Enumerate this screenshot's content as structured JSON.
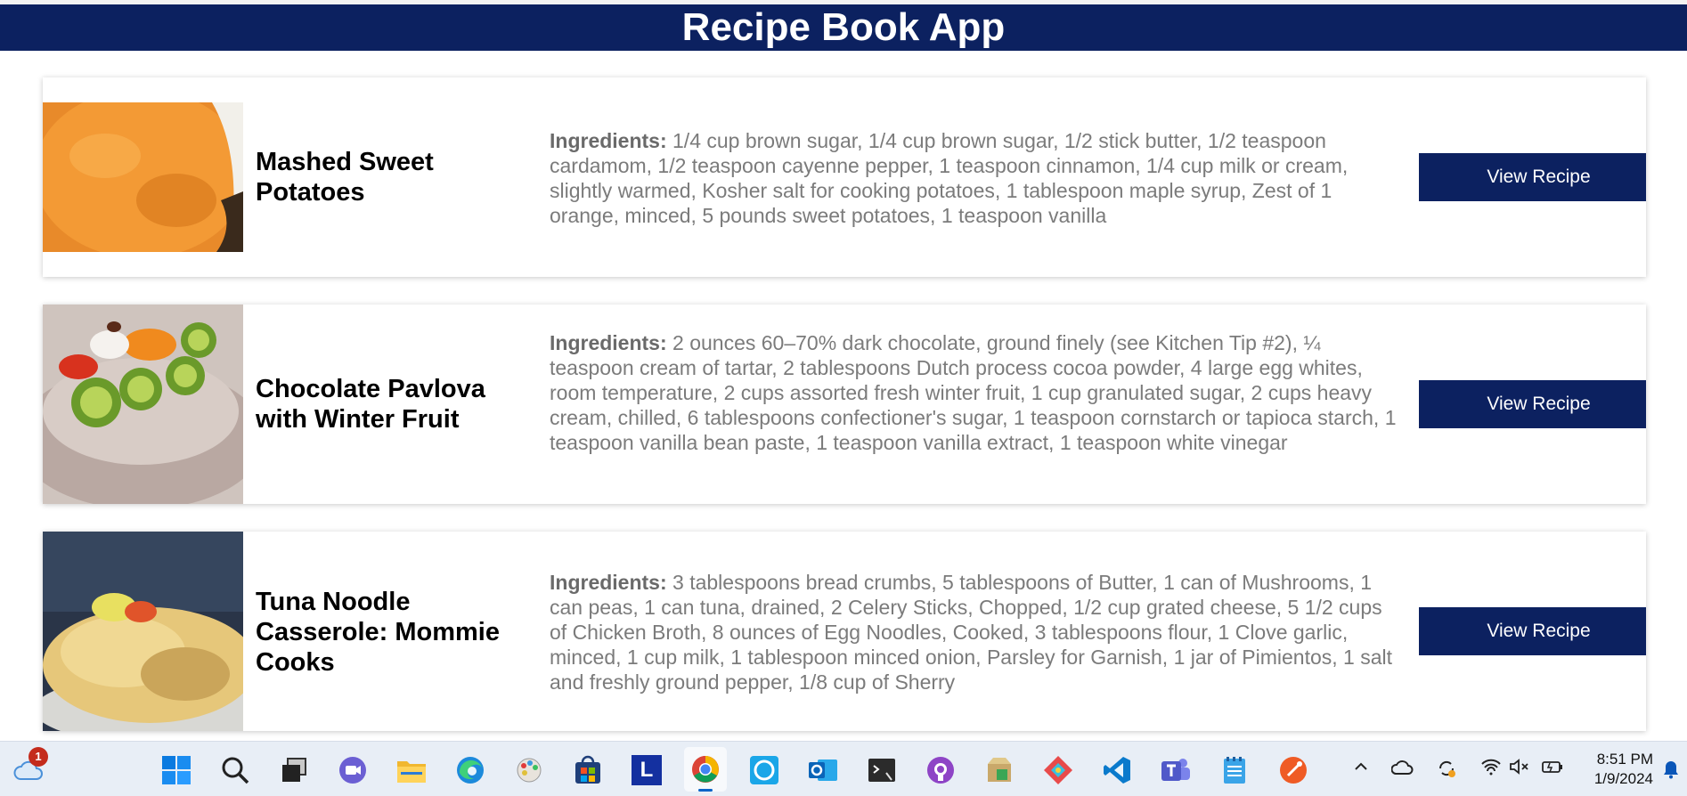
{
  "header": {
    "title": "Recipe Book App"
  },
  "recipes": [
    {
      "title": "Mashed Sweet Potatoes",
      "ingredients_label": "Ingredients:",
      "ingredients": " 1/4 cup brown sugar, 1/4 cup brown sugar, 1/2 stick butter, 1/2 teaspoon cardamom, 1/2 teaspoon cayenne pepper, 1 teaspoon cinnamon, 1/4 cup milk or cream, slightly warmed, Kosher salt for cooking potatoes, 1 tablespoon maple syrup, Zest of 1 orange, minced, 5 pounds sweet potatoes, 1 teaspoon vanilla",
      "button_label": "View Recipe"
    },
    {
      "title": "Chocolate Pavlova with Winter Fruit",
      "ingredients_label": "Ingredients:",
      "ingredients": " 2 ounces 60–70% dark chocolate, ground finely (see Kitchen Tip #2), ¼ teaspoon cream of tartar, 2 tablespoons Dutch process cocoa powder, 4 large egg whites, room temperature, 2 cups assorted fresh winter fruit, 1 cup granulated sugar, 2 cups heavy cream, chilled, 6 tablespoons confectioner's sugar, 1 teaspoon cornstarch or tapioca starch, 1 teaspoon vanilla bean paste, 1 teaspoon vanilla extract, 1 teaspoon white vinegar",
      "button_label": "View Recipe"
    },
    {
      "title": "Tuna Noodle Casserole: Mommie Cooks",
      "ingredients_label": "Ingredients:",
      "ingredients": " 3 tablespoons bread crumbs, 5 tablespoons of Butter, 1 can of Mushrooms, 1 can peas, 1 can tuna, drained, 2 Celery Sticks, Chopped, 1/2 cup grated cheese, 5 1/2 cups of Chicken Broth, 8 ounces of Egg Noodles, Cooked, 3 tablespoons flour, 1 Clove garlic, minced, 1 cup milk, 1 tablespoon minced onion, Parsley for Garnish, 1 jar of Pimientos, 1 salt and freshly ground pepper, 1/8 cup of Sherry",
      "button_label": "View Recipe"
    }
  ],
  "taskbar": {
    "weather_badge": "1",
    "start_letter": "L",
    "icons": [
      "weather-icon",
      "windows-start-icon",
      "search-icon",
      "task-view-icon",
      "meet-icon",
      "file-explorer-icon",
      "edge-icon",
      "paint-icon",
      "store-icon",
      "l-app-icon",
      "chrome-icon",
      "alexa-icon",
      "outlook-icon",
      "terminal-icon",
      "github-icon",
      "archive-icon",
      "git-icon",
      "vscode-icon",
      "teams-icon",
      "notepad-icon",
      "postman-icon"
    ],
    "time": "8:51 PM",
    "date": "1/9/2024"
  },
  "colors": {
    "header": "#0c2160",
    "button": "#0c2160",
    "accent": "#0a64c8"
  }
}
